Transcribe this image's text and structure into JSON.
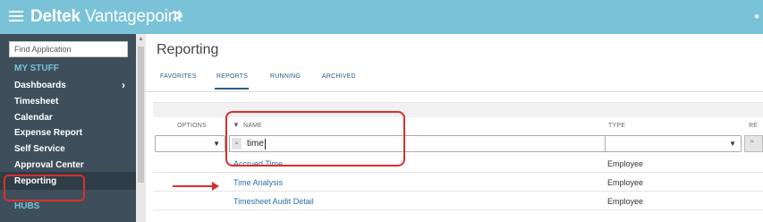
{
  "app": {
    "brand_bold": "Deltek",
    "brand_light": "Vantagepoint",
    "brand_chevron": ">",
    "menu_icon": "hamburger-menu-icon"
  },
  "sidebar": {
    "search_placeholder": "Find Application",
    "group_label": "MY STUFF",
    "items": [
      {
        "label": "Dashboards",
        "has_chevron": true
      },
      {
        "label": "Timesheet"
      },
      {
        "label": "Calendar"
      },
      {
        "label": "Expense Report"
      },
      {
        "label": "Self Service"
      },
      {
        "label": "Approval Center"
      },
      {
        "label": "Reporting",
        "active": true
      }
    ],
    "hubs_label": "HUBS",
    "chevron_glyph": "›"
  },
  "page": {
    "title": "Reporting",
    "tabs": [
      {
        "label": "FAVORITES"
      },
      {
        "label": "REPORTS",
        "active": true
      },
      {
        "label": "RUNNING"
      },
      {
        "label": "ARCHIVED"
      }
    ]
  },
  "grid": {
    "headers": {
      "options": "OPTIONS",
      "name": "NAME",
      "type": "TYPE",
      "extra": "RE"
    },
    "filter": {
      "name_operator": "≈",
      "name_value": "time"
    },
    "rows": [
      {
        "name": "Accrued Time",
        "type": "Employee"
      },
      {
        "name": "Time Analysis",
        "type": "Employee"
      },
      {
        "name": "Timesheet Audit Detail",
        "type": "Employee"
      }
    ]
  },
  "colors": {
    "topbar": "#79c2d8",
    "sidebar": "#3e4f5b",
    "link": "#2a6fa8",
    "annotation": "#d9302b"
  }
}
